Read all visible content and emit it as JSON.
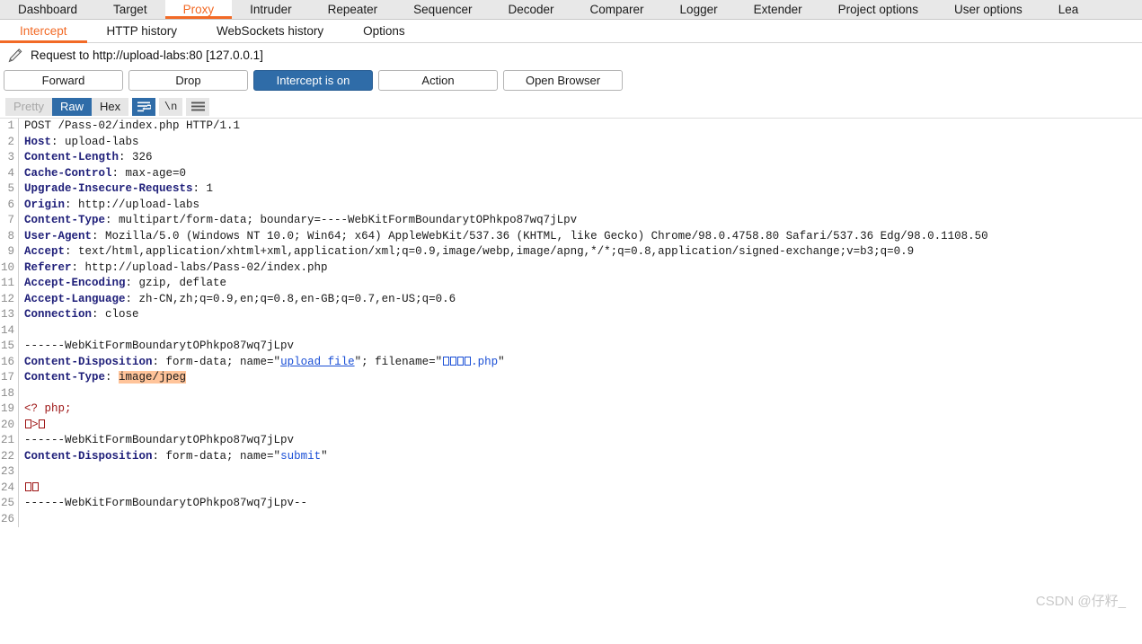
{
  "main_tabs": [
    {
      "label": "Dashboard",
      "active": false
    },
    {
      "label": "Target",
      "active": false
    },
    {
      "label": "Proxy",
      "active": true
    },
    {
      "label": "Intruder",
      "active": false
    },
    {
      "label": "Repeater",
      "active": false
    },
    {
      "label": "Sequencer",
      "active": false
    },
    {
      "label": "Decoder",
      "active": false
    },
    {
      "label": "Comparer",
      "active": false
    },
    {
      "label": "Logger",
      "active": false
    },
    {
      "label": "Extender",
      "active": false
    },
    {
      "label": "Project options",
      "active": false
    },
    {
      "label": "User options",
      "active": false
    },
    {
      "label": "Lea",
      "active": false
    }
  ],
  "sub_tabs": [
    {
      "label": "Intercept",
      "active": true
    },
    {
      "label": "HTTP history",
      "active": false
    },
    {
      "label": "WebSockets history",
      "active": false
    },
    {
      "label": "Options",
      "active": false
    }
  ],
  "request_title": "Request to http://upload-labs:80  [127.0.0.1]",
  "action_buttons": [
    {
      "label": "Forward",
      "primary": false
    },
    {
      "label": "Drop",
      "primary": false
    },
    {
      "label": "Intercept is on",
      "primary": true
    },
    {
      "label": "Action",
      "primary": false
    },
    {
      "label": "Open Browser",
      "primary": false
    }
  ],
  "view_toolbar": {
    "segments": [
      {
        "label": "Pretty",
        "state": "disabled"
      },
      {
        "label": "Raw",
        "state": "active"
      },
      {
        "label": "Hex",
        "state": "normal"
      }
    ],
    "icons": [
      {
        "name": "word-wrap-icon",
        "active": true
      },
      {
        "name": "show-newlines-icon",
        "label": "\\n",
        "active": false
      },
      {
        "name": "menu-icon",
        "active": false
      }
    ]
  },
  "colors": {
    "accent_orange": "#f26a26",
    "accent_blue": "#2f6ca8",
    "header_token": "#20207a",
    "string_token": "#1a4fd6",
    "body_token": "#9d1414",
    "highlight_bg": "#ffc49a"
  },
  "request": {
    "line_count": 26,
    "lines": [
      {
        "n": 1,
        "tokens": [
          {
            "t": "POST /Pass-02/index.php HTTP/1.1",
            "c": "tk-val"
          }
        ]
      },
      {
        "n": 2,
        "tokens": [
          {
            "t": "Host",
            "c": "tk-hdr"
          },
          {
            "t": ": upload-labs",
            "c": "tk-val"
          }
        ]
      },
      {
        "n": 3,
        "tokens": [
          {
            "t": "Content-Length",
            "c": "tk-hdr"
          },
          {
            "t": ": 326",
            "c": "tk-val"
          }
        ]
      },
      {
        "n": 4,
        "tokens": [
          {
            "t": "Cache-Control",
            "c": "tk-hdr"
          },
          {
            "t": ": max-age=0",
            "c": "tk-val"
          }
        ]
      },
      {
        "n": 5,
        "tokens": [
          {
            "t": "Upgrade-Insecure-Requests",
            "c": "tk-hdr"
          },
          {
            "t": ": 1",
            "c": "tk-val"
          }
        ]
      },
      {
        "n": 6,
        "tokens": [
          {
            "t": "Origin",
            "c": "tk-hdr"
          },
          {
            "t": ": http://upload-labs",
            "c": "tk-val"
          }
        ]
      },
      {
        "n": 7,
        "tokens": [
          {
            "t": "Content-Type",
            "c": "tk-hdr"
          },
          {
            "t": ": multipart/form-data; boundary=----WebKitFormBoundarytOPhkpo87wq7jLpv",
            "c": "tk-val"
          }
        ]
      },
      {
        "n": 8,
        "tokens": [
          {
            "t": "User-Agent",
            "c": "tk-hdr"
          },
          {
            "t": ": Mozilla/5.0 (Windows NT 10.0; Win64; x64) AppleWebKit/537.36 (KHTML, like Gecko) Chrome/98.0.4758.80 Safari/537.36 Edg/98.0.1108.50",
            "c": "tk-val"
          }
        ]
      },
      {
        "n": 9,
        "tokens": [
          {
            "t": "Accept",
            "c": "tk-hdr"
          },
          {
            "t": ": text/html,application/xhtml+xml,application/xml;q=0.9,image/webp,image/apng,*/*;q=0.8,application/signed-exchange;v=b3;q=0.9",
            "c": "tk-val"
          }
        ]
      },
      {
        "n": 10,
        "tokens": [
          {
            "t": "Referer",
            "c": "tk-hdr"
          },
          {
            "t": ": http://upload-labs/Pass-02/index.php",
            "c": "tk-val"
          }
        ]
      },
      {
        "n": 11,
        "tokens": [
          {
            "t": "Accept-Encoding",
            "c": "tk-hdr"
          },
          {
            "t": ": gzip, deflate",
            "c": "tk-val"
          }
        ]
      },
      {
        "n": 12,
        "tokens": [
          {
            "t": "Accept-Language",
            "c": "tk-hdr"
          },
          {
            "t": ": zh-CN,zh;q=0.9,en;q=0.8,en-GB;q=0.7,en-US;q=0.6",
            "c": "tk-val"
          }
        ]
      },
      {
        "n": 13,
        "tokens": [
          {
            "t": "Connection",
            "c": "tk-hdr"
          },
          {
            "t": ": close",
            "c": "tk-val"
          }
        ]
      },
      {
        "n": 14,
        "tokens": []
      },
      {
        "n": 15,
        "tokens": [
          {
            "t": "------WebKitFormBoundarytOPhkpo87wq7jLpv",
            "c": "tk-val"
          }
        ]
      },
      {
        "n": 16,
        "tokens": [
          {
            "t": "Content-Disposition",
            "c": "tk-hdr"
          },
          {
            "t": ": form-data; name=\"",
            "c": "tk-val"
          },
          {
            "t": "upload_file",
            "c": "tk-strU"
          },
          {
            "t": "\"; filename=\"",
            "c": "tk-val"
          },
          {
            "t": "\u0000\u0000\u0000\u0000",
            "c": "tk-str",
            "tofu": 4
          },
          {
            "t": ".php",
            "c": "tk-str"
          },
          {
            "t": "\"",
            "c": "tk-val"
          }
        ]
      },
      {
        "n": 17,
        "tokens": [
          {
            "t": "Content-Type",
            "c": "tk-hdr"
          },
          {
            "t": ": ",
            "c": "tk-val"
          },
          {
            "t": "image/jpeg",
            "c": "tk-hl"
          }
        ]
      },
      {
        "n": 18,
        "tokens": []
      },
      {
        "n": 19,
        "tokens": [
          {
            "t": "<? php;",
            "c": "tk-body"
          }
        ]
      },
      {
        "n": 20,
        "tokens": [
          {
            "t": "",
            "c": "tk-body",
            "tofu": 1
          },
          {
            "t": ">",
            "c": "tk-body"
          },
          {
            "t": "",
            "c": "tk-body",
            "tofu": 1
          }
        ]
      },
      {
        "n": 21,
        "tokens": [
          {
            "t": "------WebKitFormBoundarytOPhkpo87wq7jLpv",
            "c": "tk-val"
          }
        ]
      },
      {
        "n": 22,
        "tokens": [
          {
            "t": "Content-Disposition",
            "c": "tk-hdr"
          },
          {
            "t": ": form-data; name=\"",
            "c": "tk-val"
          },
          {
            "t": "submit",
            "c": "tk-str"
          },
          {
            "t": "\"",
            "c": "tk-val"
          }
        ]
      },
      {
        "n": 23,
        "tokens": []
      },
      {
        "n": 24,
        "tokens": [
          {
            "t": "",
            "c": "tk-body",
            "tofu": 2
          }
        ]
      },
      {
        "n": 25,
        "tokens": [
          {
            "t": "------WebKitFormBoundarytOPhkpo87wq7jLpv--",
            "c": "tk-val"
          }
        ]
      },
      {
        "n": 26,
        "tokens": []
      }
    ]
  },
  "watermark": "CSDN @仔籽_"
}
